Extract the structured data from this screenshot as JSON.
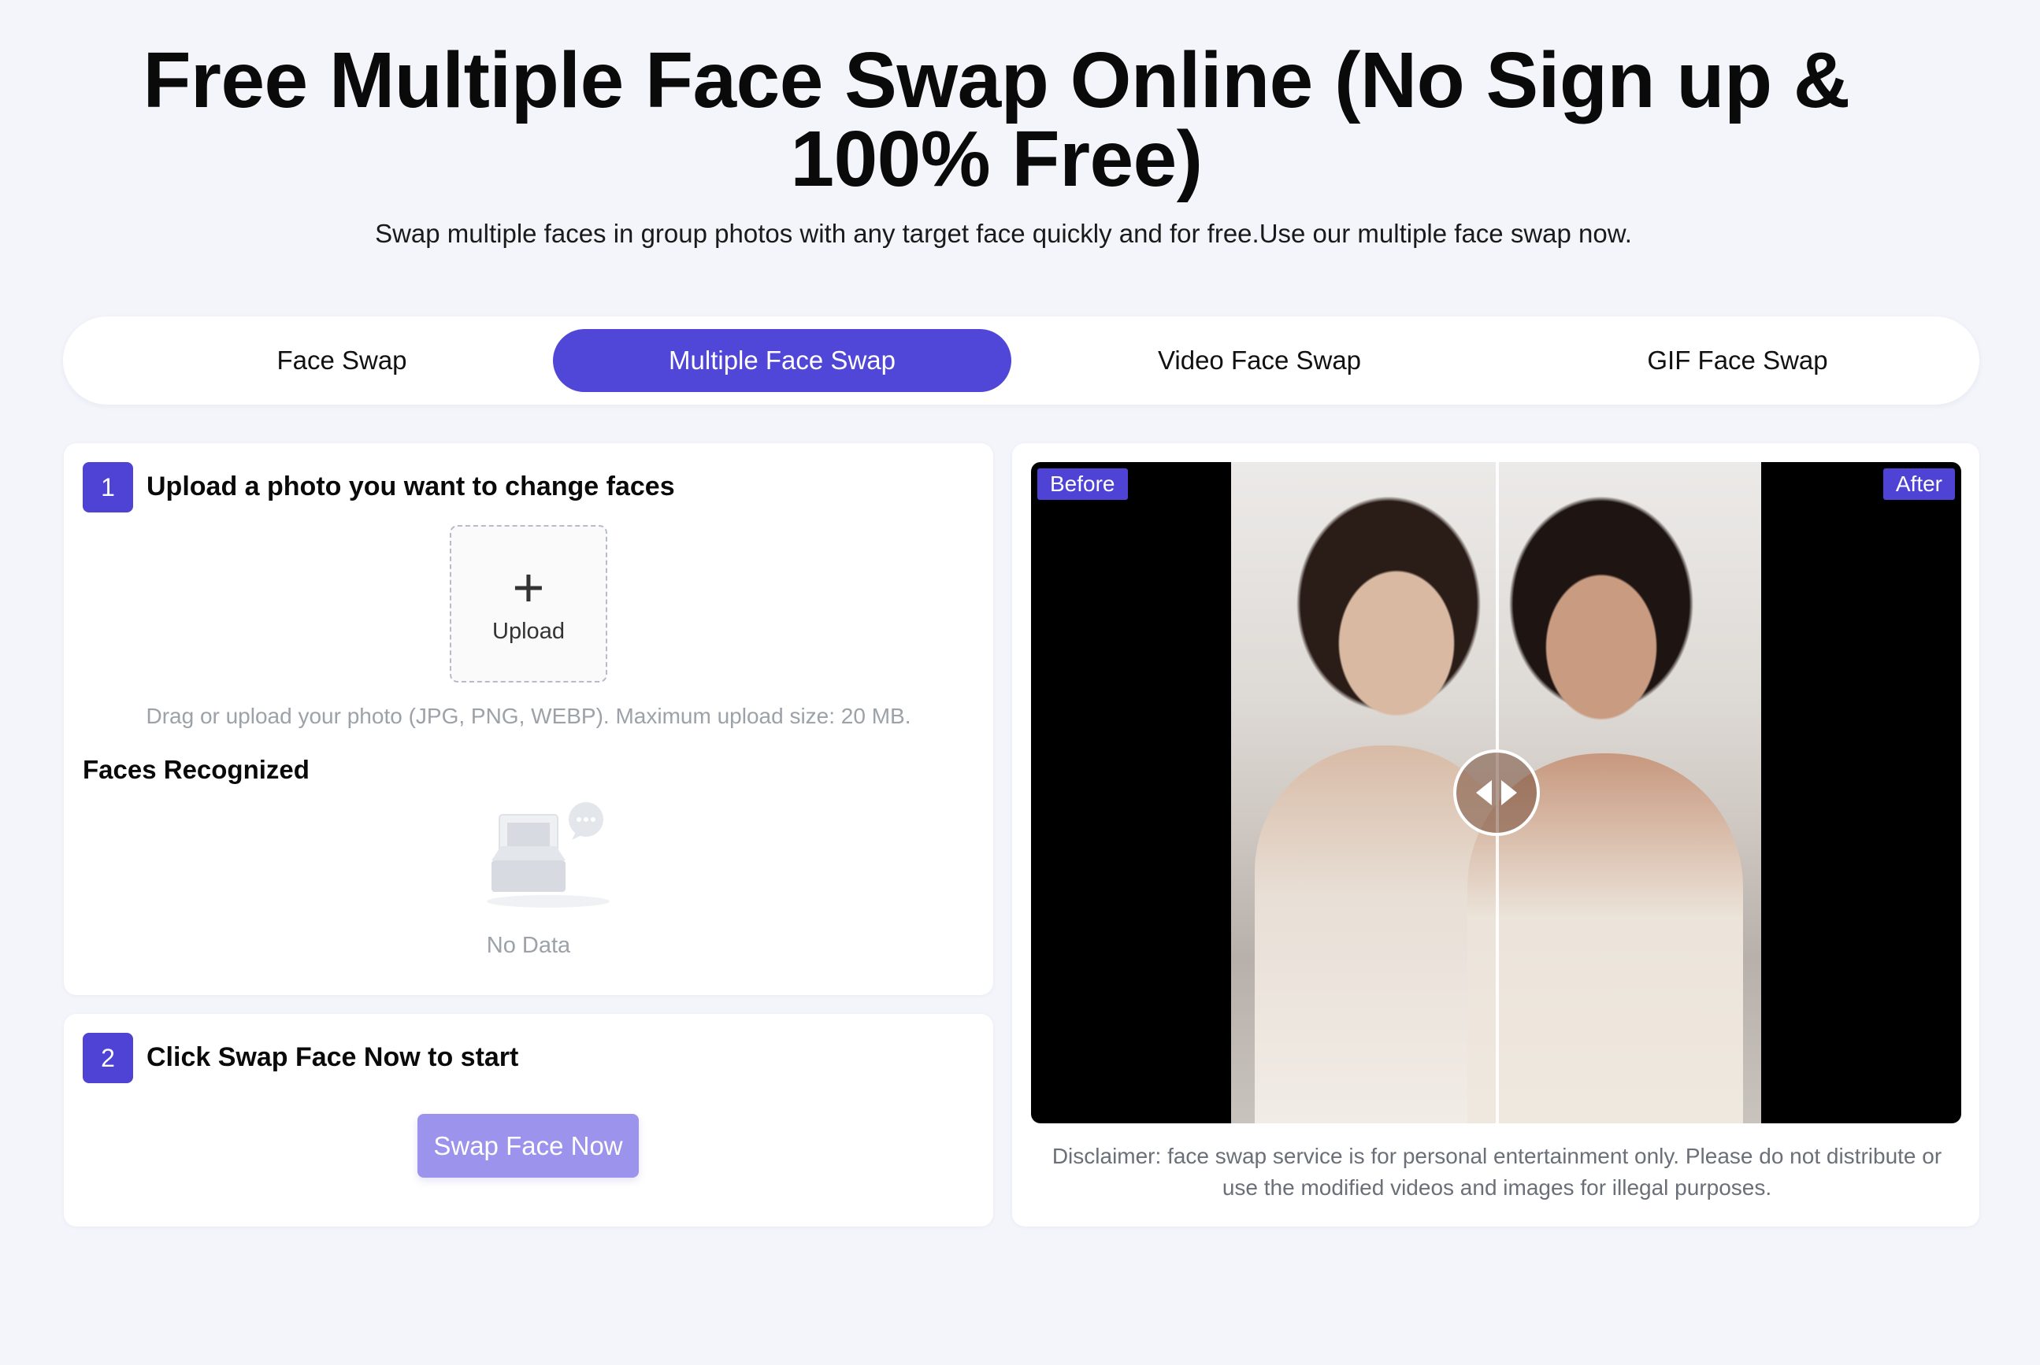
{
  "header": {
    "title": "Free Multiple Face Swap Online (No Sign up & 100% Free)",
    "subtitle": "Swap multiple faces in group photos with any target face quickly and for free.Use our multiple face swap now."
  },
  "tabs": [
    {
      "label": "Face Swap",
      "active": false
    },
    {
      "label": "Multiple Face Swap",
      "active": true
    },
    {
      "label": "Video Face Swap",
      "active": false
    },
    {
      "label": "GIF Face Swap",
      "active": false
    }
  ],
  "step1": {
    "number": "1",
    "title": "Upload a photo you want to change faces",
    "upload_label": "Upload",
    "hint": "Drag or upload your photo (JPG, PNG, WEBP). Maximum upload size: 20 MB.",
    "faces_title": "Faces Recognized",
    "empty_text": "No Data"
  },
  "step2": {
    "number": "2",
    "title": "Click Swap Face Now to start",
    "button_label": "Swap Face Now"
  },
  "preview": {
    "before_label": "Before",
    "after_label": "After",
    "disclaimer": "Disclaimer: face swap service is for personal entertainment only. Please do not distribute or use the modified videos and images for illegal purposes."
  },
  "colors": {
    "accent": "#4f43d6",
    "accent_muted": "#9b93ec",
    "page_bg": "#f4f5fb"
  }
}
